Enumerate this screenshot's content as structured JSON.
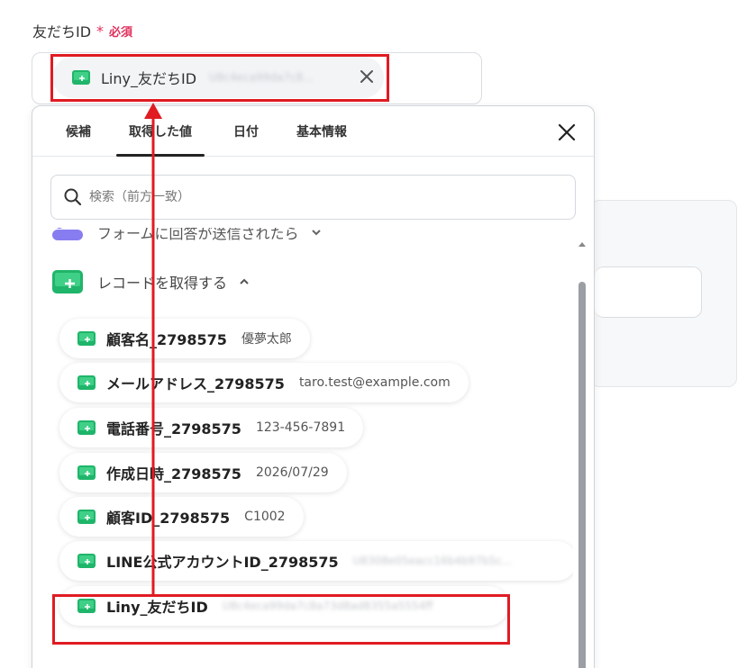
{
  "field": {
    "label": "友だちID",
    "required_star": "*",
    "required_text": "必須",
    "selected_chip": {
      "name": "Liny_友だちID",
      "value_blurred": "U8c4eca99da7c8..."
    }
  },
  "dropdown": {
    "tabs": [
      {
        "label": "候補"
      },
      {
        "label": "取得した値"
      },
      {
        "label": "日付"
      },
      {
        "label": "基本情報"
      }
    ],
    "active_tab": "取得した値",
    "search_placeholder": "検索（前方一致）",
    "groups": {
      "cut_off": {
        "name": "フォームに回答が送信されたら"
      },
      "record": {
        "name": "レコードを取得する"
      }
    },
    "items": [
      {
        "name": "顧客名_2798575",
        "value": "優夢太郎"
      },
      {
        "name": "メールアドレス_2798575",
        "value": "taro.test@example.com"
      },
      {
        "name": "電話番号_2798575",
        "value": "123-456-7891"
      },
      {
        "name": "作成日時_2798575",
        "value": "2026/07/29"
      },
      {
        "name": "顧客ID_2798575",
        "value": "C1002"
      },
      {
        "name": "LINE公式アカウントID_2798575",
        "value": "U8308e05eacc16b4b97b5c..."
      },
      {
        "name": "Liny_友だちID",
        "value": "U8c4eca99da7c8a73d8ad8355a5554ff"
      }
    ]
  },
  "colors": {
    "accent_red": "#e01b22",
    "required_pink": "#e0305c",
    "icon_green": "#1fb56a"
  },
  "icons": {
    "record_icon": "sheet-green-icon",
    "close": "close-icon",
    "search": "search-icon"
  }
}
